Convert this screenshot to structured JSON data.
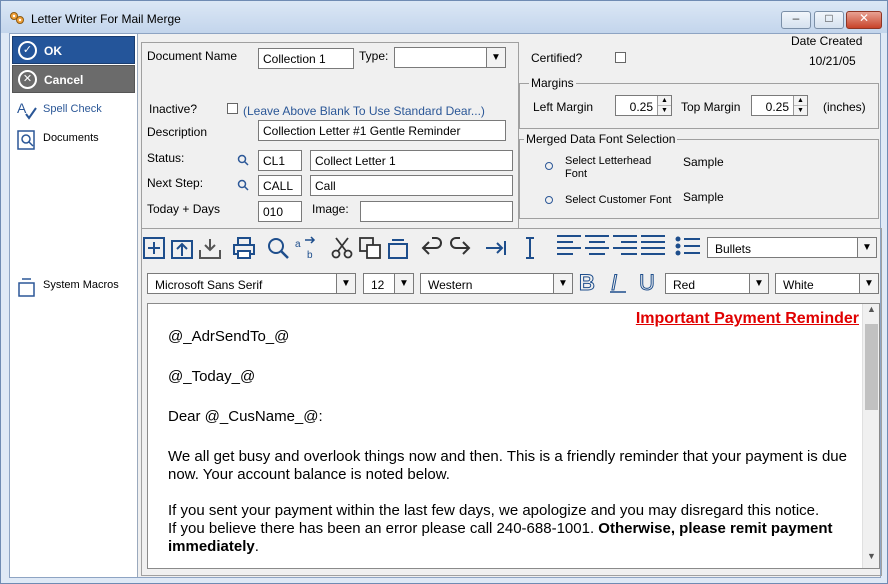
{
  "window": {
    "title": "Letter Writer For Mail Merge"
  },
  "sidebar": {
    "ok_label": "OK",
    "cancel_label": "Cancel",
    "spell_check_label": "Spell Check",
    "documents_label": "Documents",
    "system_macros_label": "System Macros"
  },
  "form": {
    "document_name_label": "Document Name",
    "document_name_value": "Collection 1",
    "type_label": "Type:",
    "type_value": "",
    "certified_label": "Certified?",
    "date_created_label": "Date Created",
    "date_created_value": "10/21/05",
    "inactive_label": "Inactive?",
    "inactive_hint": "(Leave Above Blank To Use Standard Dear...)",
    "description_label": "Description",
    "description_value": "Collection Letter #1 Gentle Reminder",
    "status_label": "Status:",
    "status_code": "CL1",
    "status_text": "Collect Letter 1",
    "next_step_label": "Next Step:",
    "next_step_code": "CALL",
    "next_step_text": "Call",
    "today_days_label": "Today + Days",
    "today_days_value": "010",
    "image_label": "Image:",
    "image_value": ""
  },
  "margins": {
    "group_label": "Margins",
    "left_label": "Left Margin",
    "left_value": "0.25",
    "top_label": "Top Margin",
    "top_value": "0.25",
    "units": "(inches)"
  },
  "fonts": {
    "group_label": "Merged Data Font Selection",
    "letterhead_label": "Select Letterhead Font",
    "letterhead_sample": "Sample",
    "customer_label": "Select Customer Font",
    "customer_sample": "Sample"
  },
  "format_toolbar": {
    "bullets": "Bullets",
    "font_name": "Microsoft Sans Serif",
    "font_size": "12",
    "script": "Western",
    "fore_color": "Red",
    "back_color": "White"
  },
  "editor": {
    "header": "Important Payment Reminder",
    "line1": "@_AdrSendTo_@",
    "line2": "@_Today_@",
    "line3": "Dear @_CusName_@:",
    "para1": "We all get busy and overlook things now and then.  This is a friendly reminder that your payment is due now.  Your account balance is noted below.",
    "para2a": "If you sent your payment within the last few days, we apologize and you may disregard this notice.",
    "para2b": "If you believe there has been an error please call 240-688-1001.  ",
    "para2c": "Otherwise, please remit payment immediately",
    "para2d": "."
  },
  "colors": {
    "header_red": "#e00000",
    "ok_blue": "#24559a",
    "cancel_gray": "#6b6b6b"
  }
}
